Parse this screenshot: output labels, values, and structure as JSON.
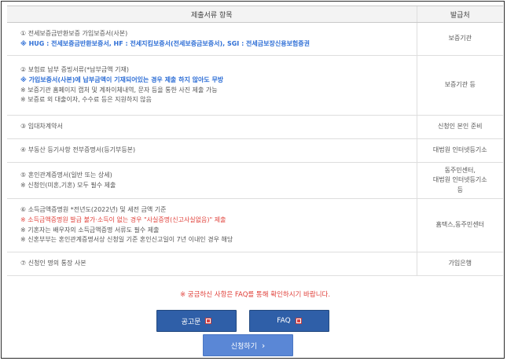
{
  "table": {
    "header_item": "제출서류 항목",
    "header_issuer": "발급처",
    "rows": [
      {
        "lines": [
          {
            "text": "① 전세보증금반환보증 가입보증서(사본)",
            "style": "normal"
          },
          {
            "text": "※ HUG : 전세보증금반환보증서, HF : 전세지킴보증서(전세보증금보증서), SGI : 전세금보장신용보험증권",
            "style": "blue"
          }
        ],
        "issuer": "보증기관"
      },
      {
        "lines": [
          {
            "text": "② 보험료 납부 증빙서류(*납부금액 기재)",
            "style": "normal"
          },
          {
            "text": "※ 가입보증서(사본)에 납부금액이 기재되어있는 경우 제출 하지 않아도 무방",
            "style": "blue"
          },
          {
            "text": "※ 보증기관 홈페이지 캡처 및 계좌이체내역, 문자 등을 통한 사진 제출 가능",
            "style": "normal"
          },
          {
            "text": "※ 보증료 외 대출이자, 수수료 등은 지원하지 않음",
            "style": "normal"
          }
        ],
        "issuer": "보증기관 등"
      },
      {
        "lines": [
          {
            "text": "③ 임대차계약서",
            "style": "normal"
          }
        ],
        "issuer": "신청인 본인 준비"
      },
      {
        "lines": [
          {
            "text": "④ 부동산 등기사항 전부증명서(등기부등본)",
            "style": "normal"
          }
        ],
        "issuer": "대법원 인터넷등기소"
      },
      {
        "lines": [
          {
            "text": "⑤ 혼인관계증명서(일반 또는 상세)",
            "style": "normal"
          },
          {
            "text": "※ 신청인(미혼,기혼) 모두 필수 제출",
            "style": "normal"
          }
        ],
        "issuer": "동주민센터,\n대법원 인터넷등기소\n등"
      },
      {
        "lines": [
          {
            "text": "⑥ 소득금액증명원 *전년도(2022년) 및 세전 금액 기준",
            "style": "normal"
          },
          {
            "text": "※ 소득금액증명원 발급 불가·소득이 없는 경우 \"사실증명(신고사실없음)\" 제출",
            "style": "red"
          },
          {
            "text": "※ 기혼자는 배우자의 소득금액증명 서류도 필수 제출",
            "style": "normal"
          },
          {
            "text": "※ 신혼부부는 혼인관계증명서상 신청일 기준 혼인신고일이 7년 이내인 경우 해당",
            "style": "normal"
          }
        ],
        "issuer": "홈택스,동주민센터"
      },
      {
        "lines": [
          {
            "text": "⑦ 신청인 명의 통장 사본",
            "style": "normal"
          }
        ],
        "issuer": "가입은행"
      }
    ]
  },
  "notice": "※ 궁금하신 사항은 FAQ를 통해 확인하시기 바랍니다.",
  "buttons": {
    "announcement": "공고문",
    "faq": "FAQ",
    "apply": "신청하기"
  },
  "icons": {
    "announcement": "hwp-file-icon",
    "faq": "hwp-file-icon",
    "apply": "chevron-right-icon"
  }
}
